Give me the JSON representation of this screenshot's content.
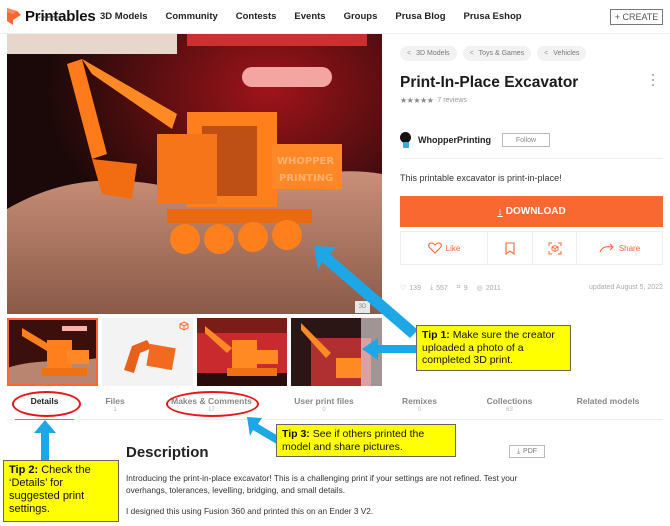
{
  "nav": {
    "logo_text": "Printables",
    "logo_sub": "by JOSEF PRUSA",
    "links": [
      "3D Models",
      "Community",
      "Contests",
      "Events",
      "Groups",
      "Prusa Blog",
      "Prusa Eshop"
    ],
    "create_label": "+ CREATE"
  },
  "gallery": {
    "badge_3d": "3D",
    "thumbnail_count": 4
  },
  "model": {
    "breadcrumbs": [
      "3D Models",
      "Toys & Games",
      "Vehicles"
    ],
    "title": "Print-In-Place Excavator",
    "rating_stars": "★★★★★",
    "rating_value": 4.5,
    "reviews": "7 reviews",
    "author": "WhopperPrinting",
    "follow_label": "Follow",
    "summary": "This printable excavator is print-in-place!",
    "download_label": "DOWNLOAD",
    "actions": {
      "like": "Like",
      "share": "Share"
    },
    "stats": {
      "likes": "139",
      "downloads": "557",
      "makes": "9",
      "views": "2011",
      "updated": "updated August 5, 2022"
    }
  },
  "tabs": [
    {
      "label": "Details",
      "count": ""
    },
    {
      "label": "Files",
      "count": "1"
    },
    {
      "label": "Makes & Comments",
      "count": "17"
    },
    {
      "label": "User print files",
      "count": "0"
    },
    {
      "label": "Remixes",
      "count": "0"
    },
    {
      "label": "Collections",
      "count": "63"
    },
    {
      "label": "Related models",
      "count": ""
    }
  ],
  "description": {
    "title": "Description",
    "pdf_label": "PDF",
    "p1": "Introducing the print-in-place excavator! This is a challenging print if your settings are not refined. Test your overhangs, tolerances, levelling, bridging, and small details.",
    "p2": "I designed this using Fusion 360 and printed this on an Ender 3 V2."
  },
  "annotations": {
    "tip1_label": "Tip 1:",
    "tip1_text": " Make sure the creator uploaded a photo of a completed 3D print.",
    "tip2_label": "Tip 2:",
    "tip2_text": " Check the ‘Details’ for suggested print settings.",
    "tip3_label": "Tip 3:",
    "tip3_text": " See if others printed the model and share pictures."
  },
  "colors": {
    "brand_orange": "#fa6831",
    "tip_yellow": "#ffff00",
    "arrow_blue": "#1ea7e6",
    "highlight_red": "#e8161b"
  }
}
